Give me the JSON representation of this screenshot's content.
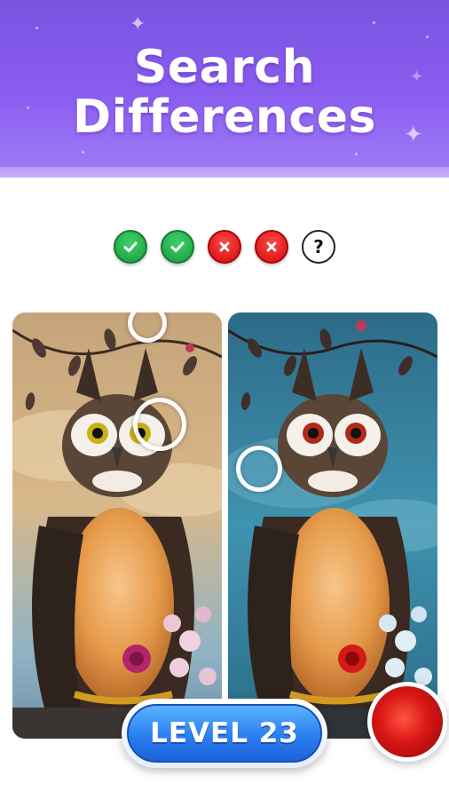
{
  "header": {
    "title_line1": "Search",
    "title_line2": "Differences",
    "background": "#8a5ef0"
  },
  "progress": {
    "items": [
      {
        "status": "found",
        "icon": "check-icon"
      },
      {
        "status": "found",
        "icon": "check-icon"
      },
      {
        "status": "missed",
        "icon": "x-icon"
      },
      {
        "status": "missed",
        "icon": "x-icon"
      },
      {
        "status": "unknown",
        "icon": "question-icon",
        "label": "?"
      }
    ],
    "colors": {
      "found": "#1fa84a",
      "missed": "#e01515"
    }
  },
  "level": {
    "label": "LEVEL 23",
    "color": "#2c7ff2"
  }
}
